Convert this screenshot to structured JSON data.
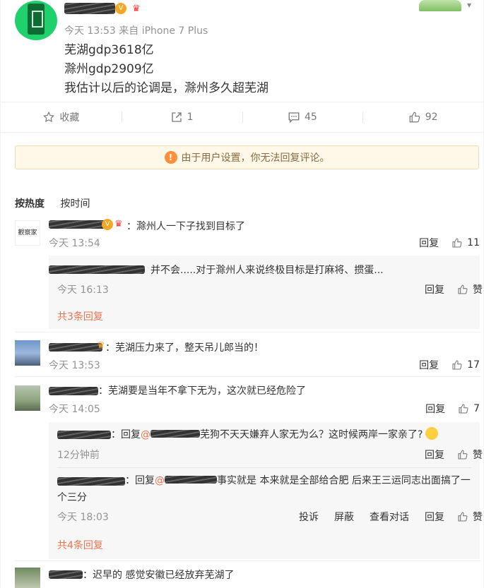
{
  "post": {
    "meta": "今天 13:53 来自 iPhone 7 Plus",
    "lines": [
      "芜湖gdp3618亿",
      "滁州gdp2909亿",
      "我估计以后的论调是，滁州多久超芜湖"
    ],
    "actions": {
      "favorite_label": "收藏",
      "repost_count": "1",
      "comment_count": "45",
      "like_count": "92"
    }
  },
  "notice": {
    "text": "由于用户设置，你无法回复评论。"
  },
  "sort": {
    "hot": "按热度",
    "time": "按时间"
  },
  "common": {
    "reply": "回复",
    "like": "赞",
    "report": "投诉",
    "block": "屏蔽",
    "view_conv": "查看对话"
  },
  "comments": [
    {
      "text": "：滁州人一下子找到目标了",
      "time": "今天 13:54",
      "likes": "11",
      "avatar_label": "觀察家",
      "replies": [
        {
          "text": "：并不会.....对于滁州人来说终极目标是打麻将、掼蛋...",
          "time": "今天 16:13"
        }
      ],
      "more": "共3条回复"
    },
    {
      "text": "：芜湖压力来了，整天吊儿郎当的！",
      "time": "今天 13:53",
      "likes": "17"
    },
    {
      "text": "：芜湖要是当年不拿下无为，这次就已经危险了",
      "time": "今天 14:05",
      "likes": "7",
      "replies": [
        {
          "prefix": "：回复",
          "link": "@",
          "text": "芜狗不天天嫌弃人家无为么？这时候两岸一家亲了?",
          "time": "12分钟前"
        },
        {
          "prefix": "：回复",
          "link": "@",
          "text": "事实就是 本来就是全部给合肥 后来王三运同志出面搞了一",
          "text2": "个三分",
          "time": "今天 18:03"
        }
      ],
      "more": "共4条回复"
    },
    {
      "text": "：迟早的 感觉安徽已经放弃芜湖了"
    }
  ]
}
